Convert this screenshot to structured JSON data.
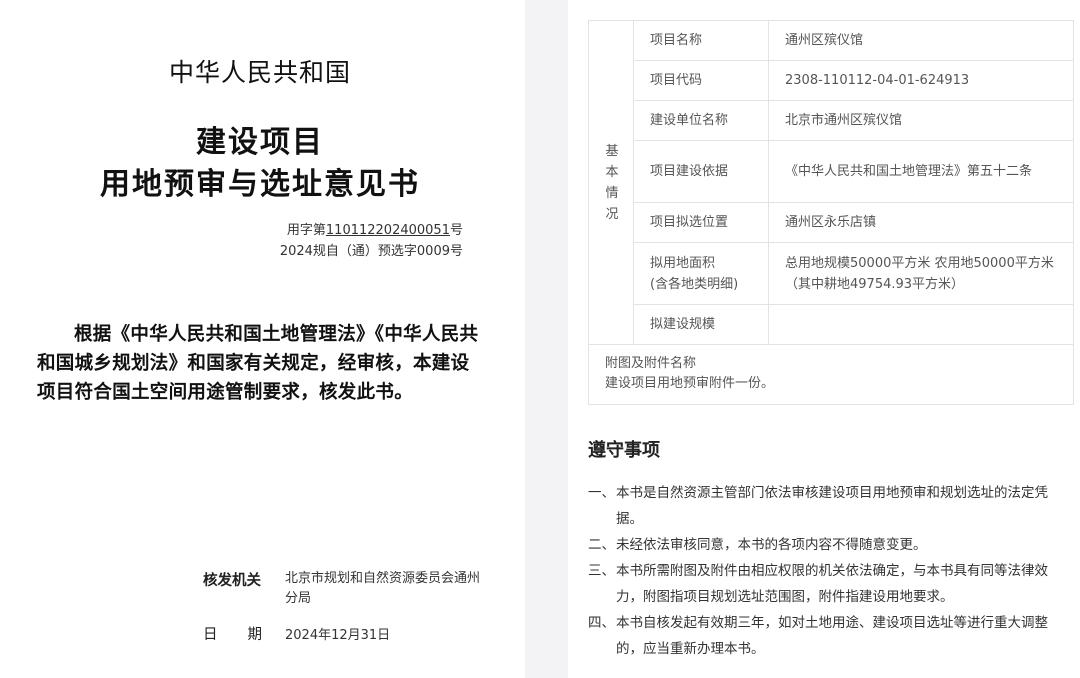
{
  "certificate": {
    "country": "中华人民共和国",
    "title_line1": "建设项目",
    "title_line2": "用地预审与选址意见书",
    "doc_prefix": "用字第",
    "doc_number": "110112202400051",
    "doc_suffix": "号",
    "doc_no2": "2024规自（通）预选字0009号",
    "body": "根据《中华人民共和国土地管理法》《中华人民共和国城乡规划法》和国家有关规定，经审核，本建设项目符合国土空间用途管制要求，核发此书。",
    "issuer_label": "核发机关",
    "issuer_value": "北京市规划和自然资源委员会通州分局",
    "date_label_a": "日",
    "date_label_b": "期",
    "date_value": "2024年12月31日"
  },
  "info_table": {
    "side_label": "基本情况",
    "rows": [
      {
        "label": "项目名称",
        "value": "通州区殡仪馆"
      },
      {
        "label": "项目代码",
        "value": "2308-110112-04-01-624913"
      },
      {
        "label": "建设单位名称",
        "value": "北京市通州区殡仪馆"
      },
      {
        "label": "项目建设依据",
        "value": "《中华人民共和国土地管理法》第五十二条"
      },
      {
        "label": "项目拟选位置",
        "value": "通州区永乐店镇"
      },
      {
        "label": "拟用地面积\n(含各地类明细)",
        "value": "总用地规模50000平方米 农用地50000平方米（其中耕地49754.93平方米）"
      },
      {
        "label": "拟建设规模",
        "value": ""
      }
    ],
    "attachment_label": "附图及附件名称",
    "attachment_value": "建设项目用地预审附件一份。"
  },
  "notices": {
    "title": "遵守事项",
    "items": [
      {
        "num": "一、",
        "text": "本书是自然资源主管部门依法审核建设项目用地预审和规划选址的法定凭据。"
      },
      {
        "num": "二、",
        "text": "未经依法审核同意，本书的各项内容不得随意变更。"
      },
      {
        "num": "三、",
        "text": "本书所需附图及附件由相应权限的机关依法确定，与本书具有同等法律效力，附图指项目规划选址范围图，附件指建设用地要求。"
      },
      {
        "num": "四、",
        "text": "本书自核发起有效期三年，如对土地用途、建设项目选址等进行重大调整的，应当重新办理本书。"
      }
    ]
  }
}
